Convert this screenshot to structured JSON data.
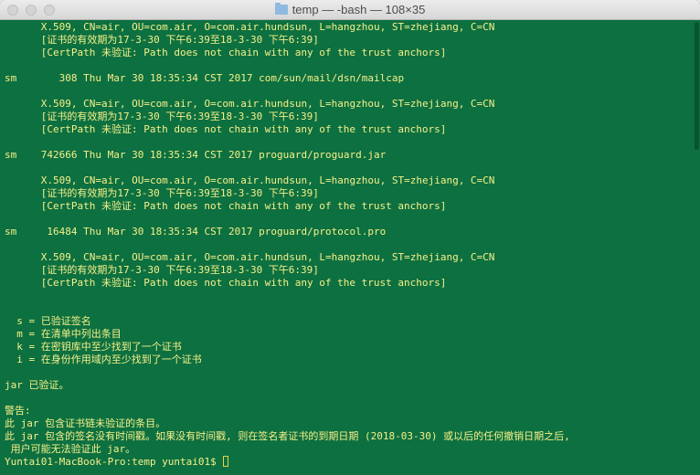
{
  "window": {
    "title": "temp — -bash — 108×35",
    "controls": [
      "close",
      "minimize",
      "zoom"
    ],
    "icons": {
      "title": "folder-icon"
    }
  },
  "colors": {
    "background": "#0d7040",
    "text": "#f6f08a"
  },
  "terminal": {
    "lines": [
      "      X.509, CN=air, OU=com.air, O=com.air.hundsun, L=hangzhou, ST=zhejiang, C=CN",
      "      [证书的有效期为17-3-30 下午6:39至18-3-30 下午6:39]",
      "      [CertPath 未验证: Path does not chain with any of the trust anchors]",
      "",
      "sm       308 Thu Mar 30 18:35:34 CST 2017 com/sun/mail/dsn/mailcap",
      "",
      "      X.509, CN=air, OU=com.air, O=com.air.hundsun, L=hangzhou, ST=zhejiang, C=CN",
      "      [证书的有效期为17-3-30 下午6:39至18-3-30 下午6:39]",
      "      [CertPath 未验证: Path does not chain with any of the trust anchors]",
      "",
      "sm    742666 Thu Mar 30 18:35:34 CST 2017 proguard/proguard.jar",
      "",
      "      X.509, CN=air, OU=com.air, O=com.air.hundsun, L=hangzhou, ST=zhejiang, C=CN",
      "      [证书的有效期为17-3-30 下午6:39至18-3-30 下午6:39]",
      "      [CertPath 未验证: Path does not chain with any of the trust anchors]",
      "",
      "sm     16484 Thu Mar 30 18:35:34 CST 2017 proguard/protocol.pro",
      "",
      "      X.509, CN=air, OU=com.air, O=com.air.hundsun, L=hangzhou, ST=zhejiang, C=CN",
      "      [证书的有效期为17-3-30 下午6:39至18-3-30 下午6:39]",
      "      [CertPath 未验证: Path does not chain with any of the trust anchors]",
      "",
      "",
      "  s = 已验证签名",
      "  m = 在清单中列出条目",
      "  k = 在密钥库中至少找到了一个证书",
      "  i = 在身份作用域内至少找到了一个证书",
      "",
      "jar 已验证。",
      "",
      "警告:",
      "此 jar 包含证书链未验证的条目。",
      "此 jar 包含的签名没有时间戳。如果没有时间戳, 则在签名者证书的到期日期 (2018-03-30) 或以后的任何撤销日期之后,",
      " 用户可能无法验证此 jar。"
    ],
    "prompt": "Yuntai01-MacBook-Pro:temp yuntai01$ "
  }
}
